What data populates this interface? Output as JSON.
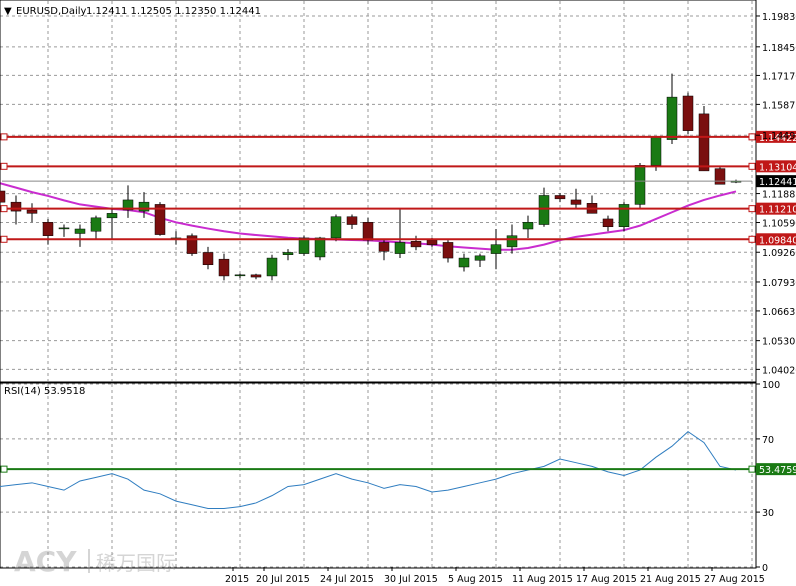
{
  "header": {
    "symbol_text": "EURUSD,Daily",
    "ohlc_text": "1.12411 1.12505 1.12350 1.12441",
    "menu_glyph": "▼"
  },
  "price_axis": {
    "ticks": [
      "1.19830",
      "1.18450",
      "1.17170",
      "1.15875",
      "1.14495",
      "1.11885",
      "1.10590",
      "1.09260",
      "1.07930",
      "1.06635",
      "1.05305",
      "1.04020"
    ]
  },
  "rsi_axis": {
    "ticks": [
      "100",
      "70",
      "30",
      "0"
    ]
  },
  "time_axis": {
    "labels": [
      "2015",
      "20 Jul 2015",
      "24 Jul 2015",
      "30 Jul 2015",
      "5 Aug 2015",
      "11 Aug 2015",
      "17 Aug 2015",
      "21 Aug 2015",
      "27 Aug 2015"
    ]
  },
  "price_lines": {
    "h1": "1.14422",
    "h2": "1.13104",
    "h3": "1.12441",
    "h4": "1.11210",
    "h5": "1.09840"
  },
  "rsi": {
    "label": "RSI(14) 53.9518",
    "level_label": "53.4759"
  },
  "colors": {
    "bull": "#1a7a14",
    "bear": "#7a0f0f",
    "ma": "#c92ccf",
    "rsi": "#2f7dc0",
    "hline": "#c01818",
    "grid": "#9a9a9a"
  },
  "watermark": {
    "brand": "ACY",
    "cn": "稀万国际"
  },
  "chart_data": [
    {
      "type": "candlestick",
      "title": "EURUSD,Daily",
      "series": [
        {
          "name": "EURUSD",
          "ohlc": [
            [
              1.12,
              1.124,
              1.106,
              1.115
            ],
            [
              1.115,
              1.118,
              1.105,
              1.111
            ],
            [
              1.1115,
              1.1145,
              1.106,
              1.11
            ],
            [
              1.106,
              1.1075,
              1.096,
              1.1
            ],
            [
              1.1035,
              1.105,
              1.0995,
              1.1035
            ],
            [
              1.101,
              1.105,
              1.095,
              1.103
            ],
            [
              1.102,
              1.109,
              1.0985,
              1.108
            ],
            [
              1.108,
              1.112,
              1.098,
              1.11
            ],
            [
              1.1115,
              1.1225,
              1.108,
              1.116
            ],
            [
              1.111,
              1.1195,
              1.108,
              1.115
            ],
            [
              1.114,
              1.115,
              1.1,
              1.1005
            ],
            [
              1.099,
              1.102,
              1.096,
              1.099
            ],
            [
              1.1,
              1.101,
              1.091,
              1.092
            ],
            [
              1.0925,
              1.095,
              1.085,
              1.087
            ],
            [
              1.0895,
              1.092,
              1.08,
              1.082
            ],
            [
              1.0825,
              1.083,
              1.081,
              1.0825
            ],
            [
              1.0825,
              1.083,
              1.0805,
              1.0815
            ],
            [
              1.082,
              1.0915,
              1.08,
              1.09
            ],
            [
              1.0915,
              1.094,
              1.089,
              1.0925
            ],
            [
              1.092,
              1.1,
              1.091,
              1.099
            ],
            [
              1.0905,
              1.0995,
              1.089,
              1.099
            ],
            [
              1.099,
              1.1095,
              1.0975,
              1.1085
            ],
            [
              1.1085,
              1.1095,
              1.103,
              1.105
            ],
            [
              1.106,
              1.108,
              1.096,
              1.098
            ],
            [
              1.097,
              1.098,
              1.089,
              1.093
            ],
            [
              1.092,
              1.112,
              1.09,
              1.097
            ],
            [
              1.0975,
              1.1,
              1.0935,
              1.095
            ],
            [
              1.098,
              1.099,
              1.095,
              1.096
            ],
            [
              1.097,
              1.098,
              1.088,
              1.09
            ],
            [
              1.086,
              1.092,
              1.084,
              1.09
            ],
            [
              1.089,
              1.092,
              1.086,
              1.091
            ],
            [
              1.092,
              1.103,
              1.085,
              1.096
            ],
            [
              1.095,
              1.105,
              1.092,
              1.1
            ],
            [
              1.103,
              1.109,
              1.099,
              1.106
            ],
            [
              1.105,
              1.1215,
              1.104,
              1.118
            ],
            [
              1.118,
              1.119,
              1.115,
              1.1165
            ],
            [
              1.116,
              1.121,
              1.112,
              1.114
            ],
            [
              1.1145,
              1.118,
              1.11,
              1.11
            ],
            [
              1.1075,
              1.109,
              1.102,
              1.104
            ],
            [
              1.104,
              1.115,
              1.102,
              1.114
            ],
            [
              1.114,
              1.1325,
              1.112,
              1.1315
            ],
            [
              1.1315,
              1.1435,
              1.129,
              1.144
            ],
            [
              1.143,
              1.1725,
              1.141,
              1.162
            ],
            [
              1.1625,
              1.164,
              1.1455,
              1.147
            ],
            [
              1.1545,
              1.158,
              1.129,
              1.129
            ],
            [
              1.13,
              1.131,
              1.124,
              1.123
            ],
            [
              1.1241,
              1.1251,
              1.1235,
              1.1244
            ]
          ]
        },
        {
          "name": "MA",
          "values": [
            1.1235,
            1.1215,
            1.1195,
            1.1178,
            1.1158,
            1.114,
            1.113,
            1.112,
            1.1115,
            1.1105,
            1.108,
            1.106,
            1.1045,
            1.1032,
            1.102,
            1.101,
            1.1003,
            1.0997,
            1.0991,
            1.0987,
            1.0985,
            1.0983,
            1.0981,
            1.0979,
            1.0975,
            1.097,
            1.0966,
            1.096,
            1.0953,
            1.0947,
            1.0942,
            1.0937,
            1.0937,
            1.0945,
            1.096,
            1.098,
            1.0995,
            1.1005,
            1.1015,
            1.1025,
            1.1045,
            1.1075,
            1.1105,
            1.1135,
            1.116,
            1.118,
            1.1198
          ]
        }
      ],
      "ylim": [
        1.035,
        1.205
      ]
    },
    {
      "type": "line",
      "title": "RSI(14) 53.9518",
      "series": [
        {
          "name": "RSI(14)",
          "values": [
            44,
            45,
            46,
            44,
            42,
            47,
            49,
            51,
            48,
            42,
            40,
            36,
            34,
            32,
            32,
            33,
            35,
            39,
            44,
            45,
            48,
            51,
            48,
            46,
            43,
            45,
            44,
            41,
            42,
            44,
            46,
            48,
            51,
            53,
            55,
            59,
            57,
            55,
            52,
            50,
            53,
            60,
            66,
            74,
            68,
            55,
            53
          ]
        }
      ],
      "ylim": [
        0,
        100
      ],
      "reference_line": 53.4759
    }
  ]
}
